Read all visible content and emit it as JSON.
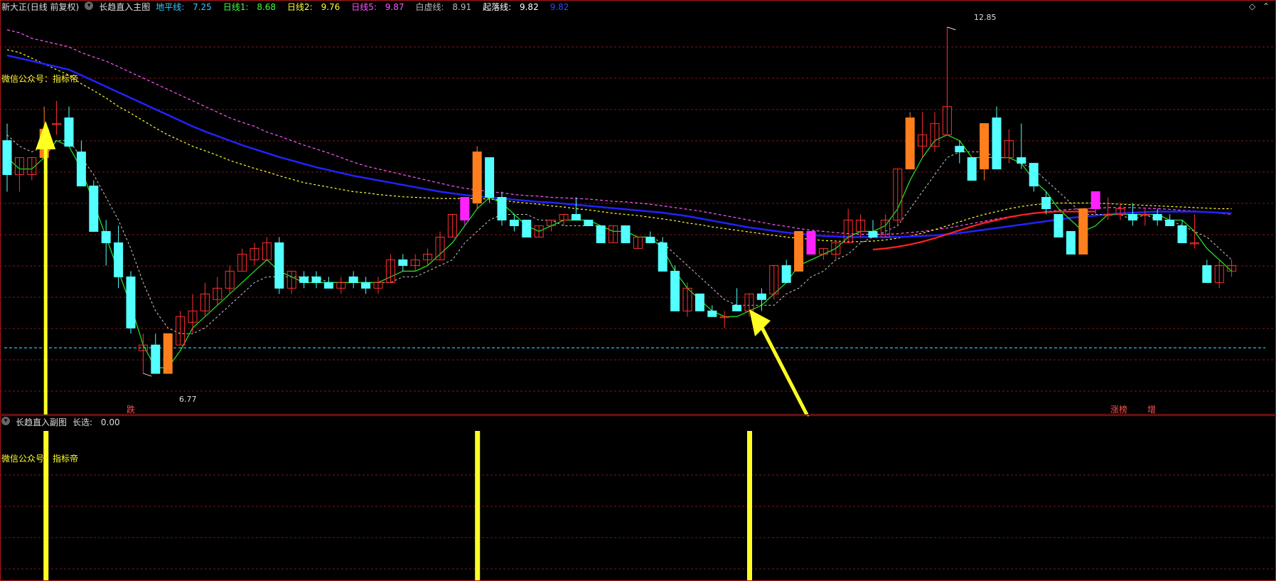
{
  "main": {
    "stock_name": "新大正",
    "period": "(日线 前复权)",
    "indicator_name": "长趋直入主图",
    "lines": [
      {
        "label": "地平线:",
        "value": "7.25",
        "color": "#37c8ff"
      },
      {
        "label": "日线1:",
        "value": "8.68",
        "color": "#3cff3c"
      },
      {
        "label": "日线2:",
        "value": "9.76",
        "color": "#ffff33"
      },
      {
        "label": "日线5:",
        "value": "9.87",
        "color": "#ff55ff"
      },
      {
        "label": "白虚线:",
        "value": "8.91",
        "color": "#b8b8b8"
      },
      {
        "label": "起落线:",
        "value": "9.82",
        "color": "#ffffff"
      }
    ],
    "trail_value": "9.82",
    "watermark": "微信公众号：指标帝",
    "high_label": "12.85",
    "low_label": "6.77",
    "signals": {
      "die": "跌",
      "zhangbang": "涨榜",
      "zeng": "增"
    }
  },
  "sub": {
    "indicator_name": "长趋直入副图",
    "value_label": "长选:",
    "value": "0.00",
    "watermark": "微信公众号：指标帝"
  },
  "icons": {
    "diamond": "◇",
    "up": "⌃",
    "dot": "▾"
  },
  "colors": {
    "up": "#ff3030",
    "down": "#54ffff",
    "orange": "#ff7f1e",
    "magenta": "#ff22ff",
    "ma_fast": "#22dd22",
    "ma_blue": "#2222ff",
    "ma_pink": "#ff55ff",
    "ma_yellow": "#ffff33",
    "signal": "#ffff22",
    "grid": "#7a1a1a",
    "floor": "#1aa5d0"
  },
  "chart_data": {
    "type": "candlestick",
    "y_range": [
      6.3,
      13.1
    ],
    "candles": [
      {
        "o": 10.9,
        "h": 11.2,
        "l": 10.0,
        "c": 10.3
      },
      {
        "o": 10.3,
        "h": 10.6,
        "l": 10.0,
        "c": 10.6
      },
      {
        "o": 10.3,
        "h": 10.6,
        "l": 10.2,
        "c": 10.6
      },
      {
        "o": 10.6,
        "h": 11.5,
        "l": 10.5,
        "c": 11.1,
        "hl": "orange"
      },
      {
        "o": 11.2,
        "h": 11.6,
        "l": 11.0,
        "c": 11.2
      },
      {
        "o": 11.3,
        "h": 11.5,
        "l": 10.8,
        "c": 10.8
      },
      {
        "o": 10.7,
        "h": 10.9,
        "l": 10.1,
        "c": 10.1
      },
      {
        "o": 10.1,
        "h": 10.2,
        "l": 9.3,
        "c": 9.3
      },
      {
        "o": 9.3,
        "h": 9.5,
        "l": 8.7,
        "c": 9.1
      },
      {
        "o": 9.1,
        "h": 9.4,
        "l": 8.3,
        "c": 8.5
      },
      {
        "o": 8.5,
        "h": 8.6,
        "l": 7.5,
        "c": 7.6
      },
      {
        "o": 7.2,
        "h": 7.5,
        "l": 6.8,
        "c": 7.3
      },
      {
        "o": 7.3,
        "h": 7.5,
        "l": 6.8,
        "c": 6.8
      },
      {
        "o": 6.8,
        "h": 7.5,
        "l": 6.8,
        "c": 7.5,
        "hl": "orange"
      },
      {
        "o": 7.3,
        "h": 7.9,
        "l": 7.3,
        "c": 7.8
      },
      {
        "o": 7.7,
        "h": 8.2,
        "l": 7.5,
        "c": 7.9
      },
      {
        "o": 7.9,
        "h": 8.4,
        "l": 7.8,
        "c": 8.2
      },
      {
        "o": 8.1,
        "h": 8.5,
        "l": 8.0,
        "c": 8.3
      },
      {
        "o": 8.3,
        "h": 8.7,
        "l": 8.2,
        "c": 8.6
      },
      {
        "o": 8.6,
        "h": 9.0,
        "l": 8.6,
        "c": 8.9
      },
      {
        "o": 8.8,
        "h": 9.1,
        "l": 8.7,
        "c": 9.0
      },
      {
        "o": 8.8,
        "h": 9.2,
        "l": 8.8,
        "c": 9.1
      },
      {
        "o": 9.1,
        "h": 9.2,
        "l": 8.2,
        "c": 8.3
      },
      {
        "o": 8.3,
        "h": 8.6,
        "l": 8.2,
        "c": 8.6
      },
      {
        "o": 8.5,
        "h": 8.6,
        "l": 8.3,
        "c": 8.4
      },
      {
        "o": 8.5,
        "h": 8.6,
        "l": 8.3,
        "c": 8.4
      },
      {
        "o": 8.4,
        "h": 8.5,
        "l": 8.3,
        "c": 8.3
      },
      {
        "o": 8.3,
        "h": 8.5,
        "l": 8.2,
        "c": 8.4
      },
      {
        "o": 8.5,
        "h": 8.6,
        "l": 8.3,
        "c": 8.4
      },
      {
        "o": 8.4,
        "h": 8.5,
        "l": 8.2,
        "c": 8.3
      },
      {
        "o": 8.3,
        "h": 8.5,
        "l": 8.2,
        "c": 8.4
      },
      {
        "o": 8.4,
        "h": 8.9,
        "l": 8.4,
        "c": 8.8
      },
      {
        "o": 8.8,
        "h": 8.9,
        "l": 8.6,
        "c": 8.7
      },
      {
        "o": 8.7,
        "h": 8.9,
        "l": 8.6,
        "c": 8.8
      },
      {
        "o": 8.8,
        "h": 9.0,
        "l": 8.7,
        "c": 8.9
      },
      {
        "o": 8.8,
        "h": 9.3,
        "l": 8.8,
        "c": 9.2
      },
      {
        "o": 9.2,
        "h": 9.6,
        "l": 9.2,
        "c": 9.6
      },
      {
        "o": 9.5,
        "h": 9.9,
        "l": 9.4,
        "c": 9.9,
        "hl": "magenta"
      },
      {
        "o": 9.8,
        "h": 10.8,
        "l": 9.7,
        "c": 10.7,
        "hl": "orange"
      },
      {
        "o": 10.6,
        "h": 10.6,
        "l": 9.8,
        "c": 9.9
      },
      {
        "o": 9.9,
        "h": 10.0,
        "l": 9.4,
        "c": 9.5
      },
      {
        "o": 9.5,
        "h": 9.6,
        "l": 9.3,
        "c": 9.4
      },
      {
        "o": 9.5,
        "h": 9.5,
        "l": 9.2,
        "c": 9.2
      },
      {
        "o": 9.2,
        "h": 9.4,
        "l": 9.2,
        "c": 9.4
      },
      {
        "o": 9.4,
        "h": 9.5,
        "l": 9.3,
        "c": 9.5
      },
      {
        "o": 9.5,
        "h": 9.6,
        "l": 9.4,
        "c": 9.6
      },
      {
        "o": 9.6,
        "h": 9.9,
        "l": 9.5,
        "c": 9.5
      },
      {
        "o": 9.5,
        "h": 9.5,
        "l": 9.4,
        "c": 9.4
      },
      {
        "o": 9.4,
        "h": 9.4,
        "l": 9.1,
        "c": 9.1
      },
      {
        "o": 9.1,
        "h": 9.4,
        "l": 9.1,
        "c": 9.4
      },
      {
        "o": 9.4,
        "h": 9.4,
        "l": 9.1,
        "c": 9.1
      },
      {
        "o": 9.0,
        "h": 9.2,
        "l": 9.0,
        "c": 9.2
      },
      {
        "o": 9.2,
        "h": 9.3,
        "l": 9.1,
        "c": 9.1
      },
      {
        "o": 9.1,
        "h": 9.2,
        "l": 8.6,
        "c": 8.6
      },
      {
        "o": 8.6,
        "h": 8.7,
        "l": 7.9,
        "c": 7.9
      },
      {
        "o": 7.9,
        "h": 8.4,
        "l": 7.8,
        "c": 8.3
      },
      {
        "o": 8.2,
        "h": 8.2,
        "l": 7.9,
        "c": 7.9
      },
      {
        "o": 7.9,
        "h": 8.0,
        "l": 7.8,
        "c": 7.8
      },
      {
        "o": 7.8,
        "h": 7.9,
        "l": 7.6,
        "c": 7.8
      },
      {
        "o": 8.0,
        "h": 8.3,
        "l": 7.9,
        "c": 7.9
      },
      {
        "o": 7.9,
        "h": 8.2,
        "l": 7.8,
        "c": 8.2
      },
      {
        "o": 8.2,
        "h": 8.3,
        "l": 7.9,
        "c": 8.1
      },
      {
        "o": 8.2,
        "h": 8.7,
        "l": 8.1,
        "c": 8.7
      },
      {
        "o": 8.7,
        "h": 8.8,
        "l": 8.4,
        "c": 8.4
      },
      {
        "o": 8.6,
        "h": 9.3,
        "l": 8.6,
        "c": 9.3,
        "hl": "orange"
      },
      {
        "o": 9.3,
        "h": 9.3,
        "l": 8.9,
        "c": 8.9,
        "hl": "magenta"
      },
      {
        "o": 8.9,
        "h": 9.0,
        "l": 8.8,
        "c": 9.0
      },
      {
        "o": 8.9,
        "h": 9.1,
        "l": 8.8,
        "c": 9.1
      },
      {
        "o": 9.1,
        "h": 9.7,
        "l": 9.1,
        "c": 9.5
      },
      {
        "o": 9.3,
        "h": 9.6,
        "l": 9.2,
        "c": 9.5
      },
      {
        "o": 9.3,
        "h": 9.5,
        "l": 9.2,
        "c": 9.2
      },
      {
        "o": 9.2,
        "h": 9.6,
        "l": 9.2,
        "c": 9.5
      },
      {
        "o": 9.5,
        "h": 10.4,
        "l": 9.4,
        "c": 10.4
      },
      {
        "o": 10.4,
        "h": 11.4,
        "l": 10.4,
        "c": 11.3,
        "hl": "orange"
      },
      {
        "o": 10.8,
        "h": 11.4,
        "l": 10.6,
        "c": 11.0
      },
      {
        "o": 10.8,
        "h": 11.4,
        "l": 10.7,
        "c": 11.2
      },
      {
        "o": 11.0,
        "h": 12.9,
        "l": 11.0,
        "c": 11.5
      },
      {
        "o": 10.8,
        "h": 10.9,
        "l": 10.5,
        "c": 10.7
      },
      {
        "o": 10.6,
        "h": 10.6,
        "l": 10.2,
        "c": 10.2
      },
      {
        "o": 10.4,
        "h": 11.2,
        "l": 10.2,
        "c": 11.2,
        "hl": "orange"
      },
      {
        "o": 11.3,
        "h": 11.5,
        "l": 10.4,
        "c": 10.4
      },
      {
        "o": 10.6,
        "h": 11.1,
        "l": 10.5,
        "c": 10.9
      },
      {
        "o": 10.6,
        "h": 11.2,
        "l": 10.4,
        "c": 10.5
      },
      {
        "o": 10.5,
        "h": 10.5,
        "l": 10.0,
        "c": 10.1
      },
      {
        "o": 9.9,
        "h": 10.0,
        "l": 9.6,
        "c": 9.7
      },
      {
        "o": 9.6,
        "h": 9.6,
        "l": 9.2,
        "c": 9.2
      },
      {
        "o": 9.3,
        "h": 9.3,
        "l": 8.9,
        "c": 8.9
      },
      {
        "o": 8.9,
        "h": 9.7,
        "l": 8.9,
        "c": 9.7,
        "hl": "orange"
      },
      {
        "o": 9.7,
        "h": 10.0,
        "l": 9.6,
        "c": 10.0,
        "hl": "magenta"
      },
      {
        "o": 9.6,
        "h": 9.9,
        "l": 9.5,
        "c": 9.6
      },
      {
        "o": 9.6,
        "h": 9.8,
        "l": 9.5,
        "c": 9.7
      },
      {
        "o": 9.6,
        "h": 9.8,
        "l": 9.4,
        "c": 9.5
      },
      {
        "o": 9.6,
        "h": 9.7,
        "l": 9.4,
        "c": 9.6
      },
      {
        "o": 9.6,
        "h": 9.7,
        "l": 9.4,
        "c": 9.5
      },
      {
        "o": 9.5,
        "h": 9.6,
        "l": 9.4,
        "c": 9.4
      },
      {
        "o": 9.4,
        "h": 9.5,
        "l": 9.1,
        "c": 9.1
      },
      {
        "o": 9.1,
        "h": 9.6,
        "l": 9.0,
        "c": 9.1
      },
      {
        "o": 8.7,
        "h": 8.8,
        "l": 8.4,
        "c": 8.4
      },
      {
        "o": 8.4,
        "h": 8.8,
        "l": 8.3,
        "c": 8.7
      },
      {
        "o": 8.6,
        "h": 8.8,
        "l": 8.5,
        "c": 8.7
      }
    ],
    "overlays": {
      "fast_ma": [
        10.6,
        10.4,
        10.4,
        10.6,
        10.9,
        10.8,
        10.4,
        9.8,
        9.2,
        8.6,
        8.0,
        7.3,
        6.9,
        6.9,
        7.2,
        7.6,
        7.8,
        8.0,
        8.2,
        8.4,
        8.6,
        8.8,
        8.6,
        8.5,
        8.4,
        8.4,
        8.4,
        8.4,
        8.4,
        8.4,
        8.4,
        8.5,
        8.6,
        8.6,
        8.7,
        8.9,
        9.1,
        9.4,
        9.7,
        9.9,
        9.8,
        9.6,
        9.4,
        9.3,
        9.4,
        9.5,
        9.5,
        9.5,
        9.4,
        9.3,
        9.3,
        9.2,
        9.2,
        9.0,
        8.6,
        8.3,
        8.1,
        7.9,
        7.8,
        7.8,
        7.9,
        8.0,
        8.2,
        8.4,
        8.7,
        8.8,
        8.9,
        9.0,
        9.2,
        9.3,
        9.3,
        9.4,
        9.7,
        10.2,
        10.6,
        10.9,
        11.0,
        10.9,
        10.6,
        10.6,
        10.6,
        10.6,
        10.5,
        10.2,
        10.0,
        9.7,
        9.5,
        9.3,
        9.4,
        9.6,
        9.6,
        9.6,
        9.6,
        9.6,
        9.5,
        9.5,
        9.3,
        9.0,
        8.8,
        8.6
      ],
      "dashed_ma": [
        11.0,
        10.8,
        10.7,
        10.8,
        10.9,
        10.9,
        10.6,
        10.3,
        9.9,
        9.5,
        9.0,
        8.4,
        7.9,
        7.6,
        7.5,
        7.5,
        7.6,
        7.8,
        8.0,
        8.2,
        8.4,
        8.5,
        8.5,
        8.5,
        8.5,
        8.5,
        8.4,
        8.4,
        8.4,
        8.4,
        8.4,
        8.4,
        8.5,
        8.5,
        8.6,
        8.7,
        8.8,
        9.1,
        9.3,
        9.5,
        9.6,
        9.6,
        9.6,
        9.5,
        9.5,
        9.4,
        9.4,
        9.4,
        9.4,
        9.3,
        9.3,
        9.2,
        9.2,
        9.1,
        8.9,
        8.7,
        8.5,
        8.3,
        8.1,
        8.0,
        8.0,
        8.0,
        8.0,
        8.2,
        8.3,
        8.5,
        8.6,
        8.8,
        8.9,
        9.1,
        9.2,
        9.3,
        9.4,
        9.7,
        10.0,
        10.3,
        10.6,
        10.7,
        10.7,
        10.7,
        10.6,
        10.6,
        10.5,
        10.4,
        10.2,
        10.0,
        9.8,
        9.6,
        9.6,
        9.6,
        9.6,
        9.5,
        9.6,
        9.5,
        9.5,
        9.4,
        9.3,
        9.2,
        9.0,
        8.8
      ],
      "blue_ma": [
        12.4,
        12.35,
        12.3,
        12.25,
        12.2,
        12.15,
        12.05,
        11.95,
        11.85,
        11.75,
        11.65,
        11.55,
        11.45,
        11.35,
        11.25,
        11.15,
        11.06,
        10.98,
        10.9,
        10.82,
        10.75,
        10.68,
        10.61,
        10.55,
        10.49,
        10.43,
        10.38,
        10.33,
        10.28,
        10.24,
        10.2,
        10.16,
        10.12,
        10.08,
        10.04,
        10.0,
        9.97,
        9.94,
        9.92,
        9.9,
        9.88,
        9.86,
        9.84,
        9.82,
        9.81,
        9.79,
        9.77,
        9.75,
        9.73,
        9.71,
        9.69,
        9.67,
        9.65,
        9.63,
        9.6,
        9.57,
        9.53,
        9.49,
        9.45,
        9.41,
        9.37,
        9.34,
        9.31,
        9.28,
        9.26,
        9.24,
        9.22,
        9.21,
        9.2,
        9.2,
        9.2,
        9.2,
        9.2,
        9.21,
        9.22,
        9.23,
        9.25,
        9.27,
        9.3,
        9.33,
        9.36,
        9.39,
        9.42,
        9.45,
        9.48,
        9.51,
        9.54,
        9.56,
        9.58,
        9.6,
        9.62,
        9.63,
        9.64,
        9.65,
        9.65,
        9.65,
        9.65,
        9.64,
        9.63,
        9.62
      ],
      "pink_ma": [
        12.85,
        12.8,
        12.7,
        12.65,
        12.6,
        12.55,
        12.45,
        12.37,
        12.3,
        12.2,
        12.1,
        12.0,
        11.9,
        11.8,
        11.7,
        11.6,
        11.5,
        11.4,
        11.3,
        11.22,
        11.15,
        11.05,
        10.98,
        10.9,
        10.82,
        10.75,
        10.68,
        10.6,
        10.52,
        10.45,
        10.4,
        10.35,
        10.3,
        10.25,
        10.2,
        10.15,
        10.1,
        10.06,
        10.03,
        10.0,
        9.98,
        9.95,
        9.93,
        9.92,
        9.9,
        9.89,
        9.88,
        9.87,
        9.85,
        9.83,
        9.82,
        9.8,
        9.78,
        9.75,
        9.72,
        9.69,
        9.66,
        9.62,
        9.58,
        9.54,
        9.5,
        9.46,
        9.42,
        9.39,
        9.35,
        9.32,
        9.3,
        9.28,
        9.26,
        9.25,
        9.25,
        9.25,
        9.26,
        9.28,
        9.3,
        9.33,
        9.36,
        9.4,
        9.44,
        9.48,
        9.52,
        9.56,
        9.59,
        9.62,
        9.65,
        9.67,
        9.69,
        9.7,
        9.71,
        9.72,
        9.72,
        9.72,
        9.71,
        9.7,
        9.69,
        9.67,
        9.66,
        9.64,
        9.62,
        9.6
      ],
      "yellow_ma": [
        12.5,
        12.45,
        12.35,
        12.25,
        12.15,
        12.05,
        11.9,
        11.78,
        11.65,
        11.5,
        11.38,
        11.25,
        11.12,
        11.0,
        10.9,
        10.8,
        10.72,
        10.64,
        10.55,
        10.48,
        10.41,
        10.35,
        10.28,
        10.22,
        10.16,
        10.12,
        10.08,
        10.04,
        10.0,
        9.98,
        9.95,
        9.93,
        9.91,
        9.9,
        9.89,
        9.88,
        9.88,
        9.88,
        9.88,
        9.87,
        9.85,
        9.82,
        9.8,
        9.78,
        9.75,
        9.73,
        9.7,
        9.68,
        9.65,
        9.62,
        9.6,
        9.58,
        9.55,
        9.52,
        9.49,
        9.45,
        9.42,
        9.38,
        9.35,
        9.32,
        9.29,
        9.26,
        9.23,
        9.2,
        9.18,
        9.16,
        9.14,
        9.13,
        9.12,
        9.12,
        9.13,
        9.15,
        9.18,
        9.22,
        9.27,
        9.33,
        9.4,
        9.47,
        9.54,
        9.6,
        9.65,
        9.7,
        9.74,
        9.77,
        9.79,
        9.8,
        9.8,
        9.8,
        9.8,
        9.79,
        9.78,
        9.77,
        9.76,
        9.75,
        9.74,
        9.73,
        9.72,
        9.71,
        9.7,
        9.7
      ],
      "floor_line": 7.25
    },
    "signal_bars_at_candle": [
      3,
      38,
      60
    ]
  }
}
